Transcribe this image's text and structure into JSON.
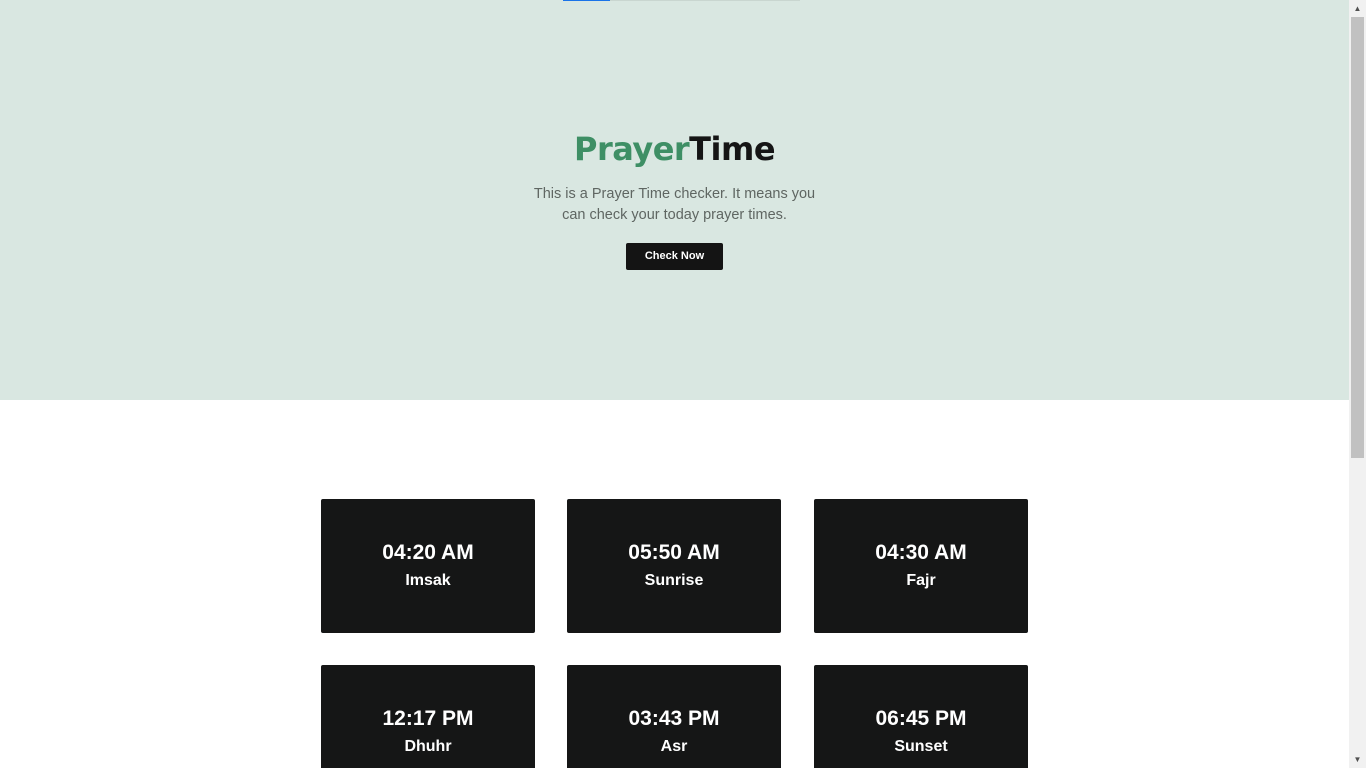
{
  "colors": {
    "hero_background": "#d9e7e1",
    "brand_green": "#3e8f65",
    "dark": "#151515",
    "card_background": "#151616",
    "loading_bar": "#1a73e8"
  },
  "loading_bar": {
    "progress": 0.2
  },
  "hero": {
    "title_part1": "Prayer",
    "title_part2": "Time",
    "subtitle": "This is a Prayer Time checker. It means you can check your today prayer times.",
    "button_label": "Check Now"
  },
  "prayers": [
    {
      "time": "04:20 AM",
      "name": "Imsak"
    },
    {
      "time": "05:50 AM",
      "name": "Sunrise"
    },
    {
      "time": "04:30 AM",
      "name": "Fajr"
    },
    {
      "time": "12:17 PM",
      "name": "Dhuhr"
    },
    {
      "time": "03:43 PM",
      "name": "Asr"
    },
    {
      "time": "06:45 PM",
      "name": "Sunset"
    }
  ],
  "scrollbar": {
    "up_icon": "triangle-up-icon",
    "down_icon": "triangle-down-icon"
  }
}
